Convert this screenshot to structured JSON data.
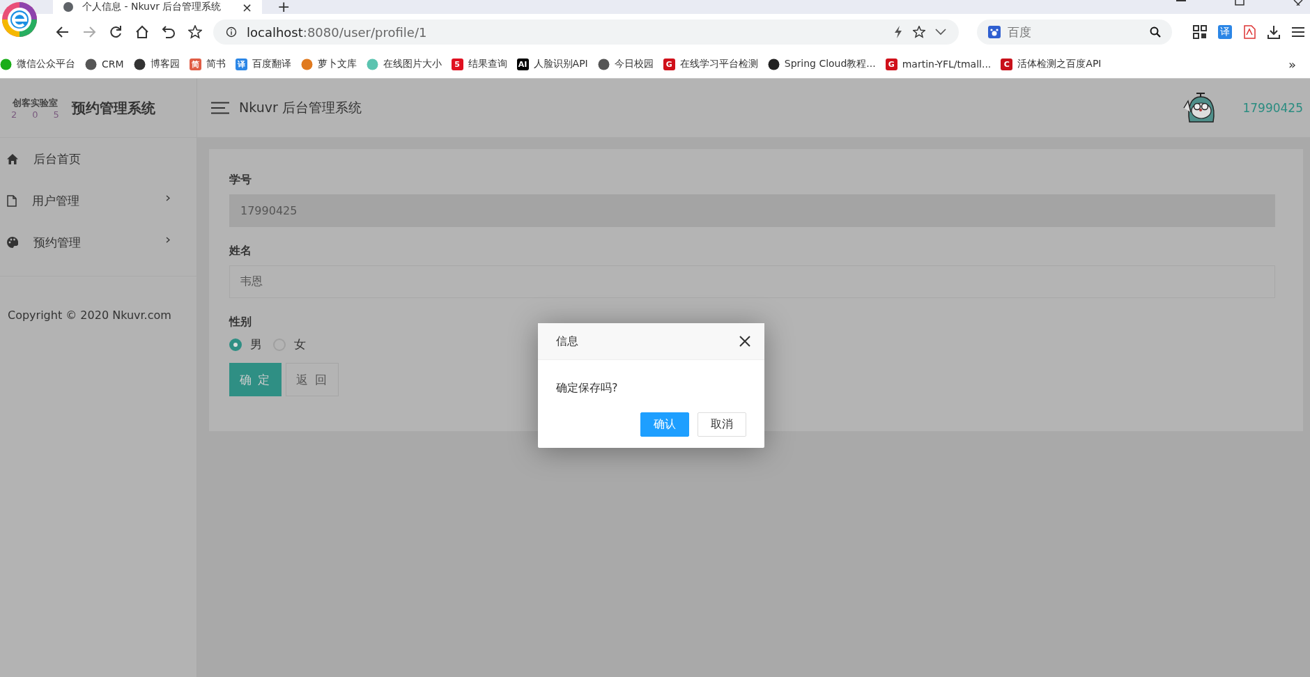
{
  "browser": {
    "tab_title": "个人信息 - Nkuvr 后台管理系统",
    "tab_close": "×",
    "new_tab": "+",
    "address_host": "localhost",
    "address_path": ":8080/user/profile/1",
    "search_placeholder": "百度",
    "translate_badge": "译",
    "overflow": "»",
    "bookmarks": [
      {
        "label": "微信公众平台",
        "color": "#1aad19"
      },
      {
        "label": "CRM",
        "color": "#555555"
      },
      {
        "label": "博客园",
        "color": "#333333"
      },
      {
        "label": "简书",
        "badge": "简",
        "color": "#e05d45"
      },
      {
        "label": "百度翻译",
        "badge": "译",
        "color": "#2b86e6"
      },
      {
        "label": "萝卜文库",
        "color": "#e07a1f"
      },
      {
        "label": "在线图片大小",
        "color": "#5bc4b0"
      },
      {
        "label": "结果查询",
        "badge": "5",
        "color": "#e01020"
      },
      {
        "label": "人脸识别API",
        "badge": "AI",
        "color": "#000000"
      },
      {
        "label": "今日校园",
        "color": "#555555"
      },
      {
        "label": "在线学习平台检测",
        "badge": "G",
        "color": "#d0101a"
      },
      {
        "label": "Spring Cloud教程...",
        "color": "#222222"
      },
      {
        "label": "martin-YFL/tmall...",
        "badge": "G",
        "color": "#d0101a"
      },
      {
        "label": "活体检测之百度API",
        "badge": "C",
        "color": "#c8101a"
      }
    ]
  },
  "sidebar": {
    "logo_text": "创客实验室",
    "logo_digits": [
      "2",
      "0",
      "5"
    ],
    "title": "预约管理系统",
    "menu": [
      {
        "label": "后台首页",
        "has_children": false
      },
      {
        "label": "用户管理",
        "has_children": true
      },
      {
        "label": "预约管理",
        "has_children": true
      }
    ],
    "copyright": "Copyright © 2020 Nkuvr.com"
  },
  "header": {
    "title": "Nkuvr 后台管理系统",
    "user": "17990425"
  },
  "form": {
    "fields": [
      {
        "label": "学号",
        "value": "17990425",
        "readonly": true
      },
      {
        "label": "姓名",
        "value": "韦恩",
        "readonly": false
      }
    ],
    "gender_label": "性别",
    "gender_options": [
      {
        "label": "男",
        "selected": true
      },
      {
        "label": "女",
        "selected": false
      }
    ],
    "buttons": [
      {
        "label": "确 定",
        "kind": "primary"
      },
      {
        "label": "返 回",
        "kind": "default"
      }
    ]
  },
  "dialog": {
    "title": "信息",
    "message": "确定保存吗?",
    "buttons": [
      {
        "label": "确认",
        "kind": "primary"
      },
      {
        "label": "取消",
        "kind": "default"
      }
    ]
  }
}
